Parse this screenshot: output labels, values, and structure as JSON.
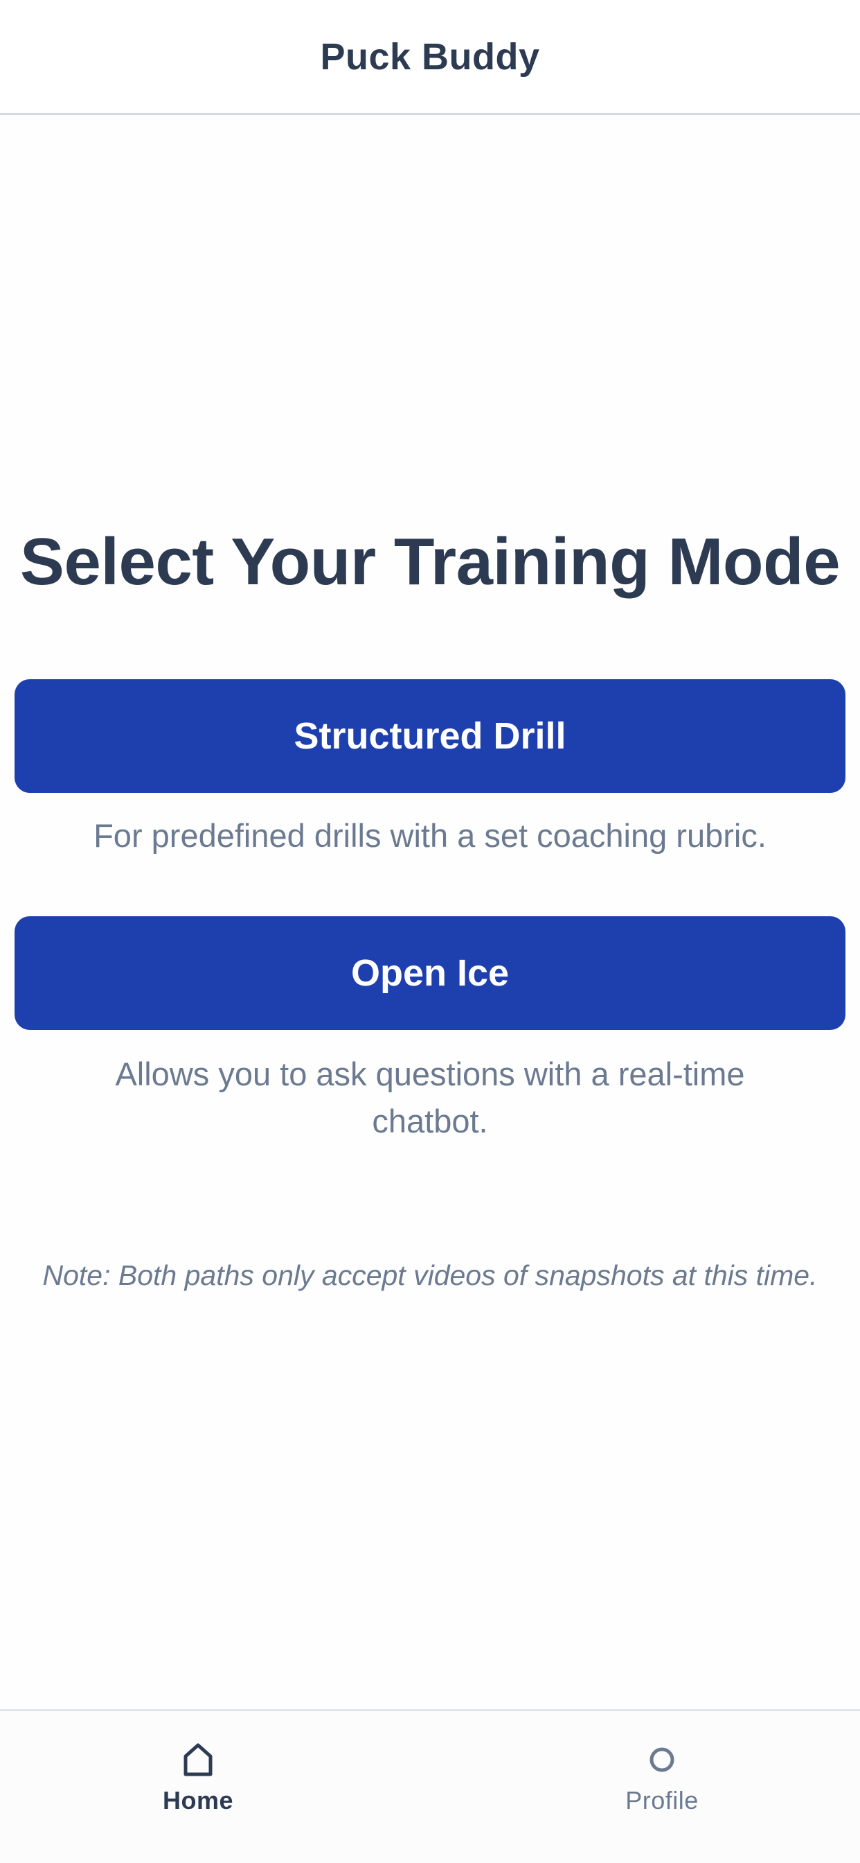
{
  "header": {
    "title": "Puck Buddy"
  },
  "main": {
    "title": "Select Your Training Mode",
    "modes": [
      {
        "label": "Structured Drill",
        "description": "For predefined drills with a set coaching rubric."
      },
      {
        "label": "Open Ice",
        "description": "Allows you to ask questions with a real-time chatbot."
      }
    ],
    "note": "Note: Both paths only accept videos of snapshots at this time."
  },
  "tabbar": {
    "tabs": [
      {
        "label": "Home",
        "icon": "home-icon",
        "active": true
      },
      {
        "label": "Profile",
        "icon": "profile-icon",
        "active": false
      }
    ]
  },
  "colors": {
    "primary_button": "#1e40af",
    "heading_text": "#2d3b52",
    "muted_text": "#6b7a90"
  }
}
